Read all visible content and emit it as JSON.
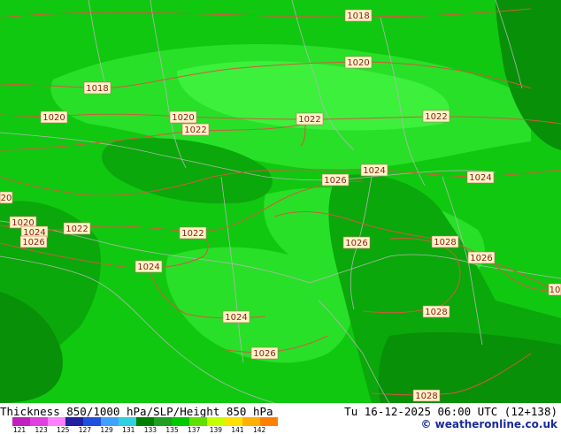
{
  "header": {
    "left_title": "Thickness 850/1000 hPa/SLP/Height 850 hPa",
    "right_title": "Tu 16-12-2025 06:00 UTC (12+138)"
  },
  "credit": "© weatheronline.co.uk",
  "legend": {
    "ticks": [
      "121",
      "123",
      "125",
      "127",
      "129",
      "131",
      "133",
      "135",
      "137",
      "139",
      "141",
      "142"
    ],
    "colors": [
      "#c020c0",
      "#e040e0",
      "#ff80ff",
      "#2020a0",
      "#2050e0",
      "#40a0ff",
      "#30d0e0",
      "#008000",
      "#20a020",
      "#00c800",
      "#60e000",
      "#c8ff00",
      "#ffe000",
      "#ffb000",
      "#ff8000"
    ]
  },
  "map": {
    "colors": {
      "base": "#10c810",
      "light": "#28e028",
      "lighter": "#3cf03c",
      "dark": "#0aa80a",
      "darker": "#089008",
      "isobar": "#d05a3c",
      "border": "#b0b8b0"
    },
    "isobar_labels": [
      "1018",
      "1020",
      "1018",
      "1020",
      "1020",
      "1022",
      "1022",
      "1022",
      "1020",
      "1024",
      "1026",
      "1024",
      "1020",
      "1024",
      "1026",
      "1022",
      "1022",
      "1026",
      "1028",
      "1026",
      "1024",
      "1024",
      "1028",
      "1026",
      "1028",
      "10"
    ]
  }
}
